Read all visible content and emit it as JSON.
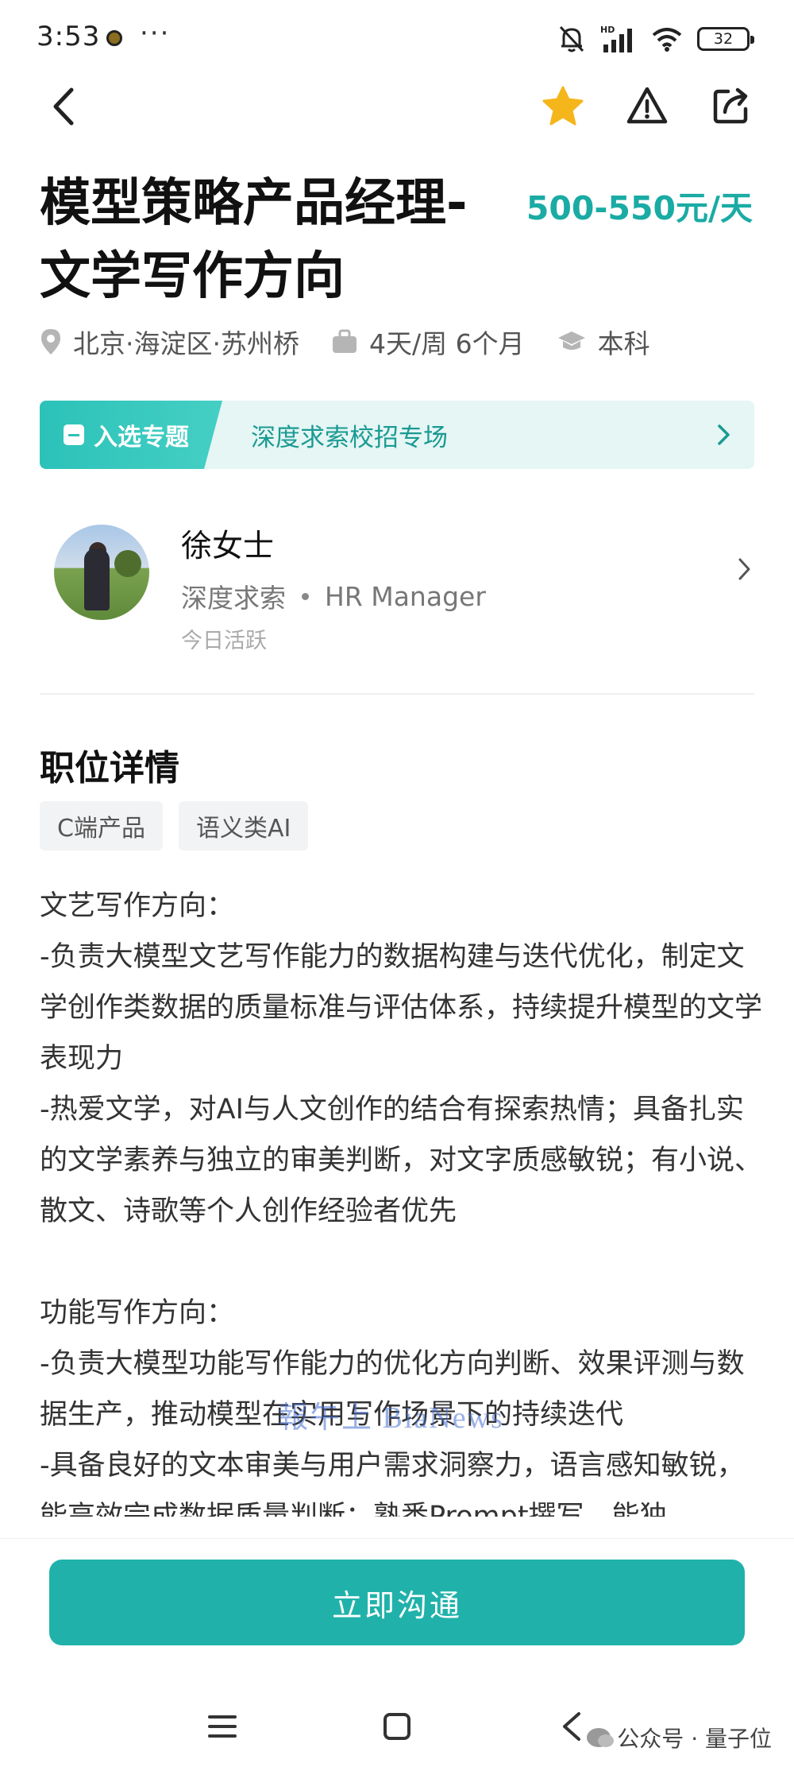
{
  "status_bar": {
    "time": "3:53",
    "more": "···",
    "battery": "32",
    "network_label": "HD"
  },
  "nav": {
    "icons": [
      "back-icon",
      "star-icon",
      "report-icon",
      "share-icon"
    ],
    "star_color": "#f5b61c"
  },
  "job": {
    "title": "模型策略产品经理-文学写作方向",
    "salary": "500-550元/天",
    "location": "北京·海淀区·苏州桥",
    "schedule": "4天/周 6个月",
    "education": "本科"
  },
  "banner": {
    "tag": "入选专题",
    "text": "深度求索校招专场"
  },
  "recruiter": {
    "name": "徐女士",
    "company": "深度求索",
    "title": "HR Manager",
    "active": "今日活跃"
  },
  "details": {
    "section_title": "职位详情",
    "tags": [
      "C端产品",
      "语义类AI"
    ],
    "description": "文艺写作方向：\n-负责大模型文艺写作能力的数据构建与迭代优化，制定文学创作类数据的质量标准与评估体系，持续提升模型的文学表现力\n-热爱文学，对AI与人文创作的结合有探索热情；具备扎实的文学素养与独立的审美判断，对文字质感敏锐；有小说、散文、诗歌等个人创作经验者优先\n\n功能写作方向：\n-负责大模型功能写作能力的优化方向判断、效果评测与数据生产，推动模型在实用写作场景下的持续迭代\n-具备良好的文本审美与用户需求洞察力，语言感知敏锐，能高效完成数据质量判断；熟悉Prompt撰写，能独"
  },
  "action": {
    "primary_label": "立即沟通"
  },
  "watermarks": {
    "center": "報午上 BiaNews",
    "corner": "公众号 · 量子位"
  },
  "colors": {
    "accent": "#20b2aa",
    "salary": "#1aaba4"
  }
}
